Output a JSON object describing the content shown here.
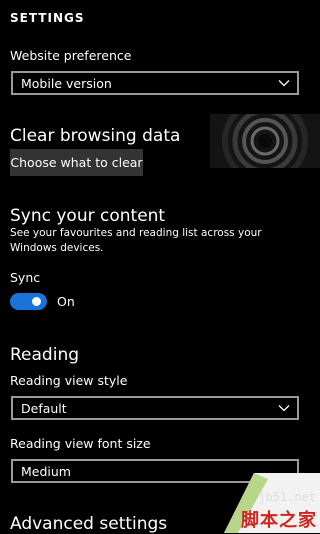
{
  "header": {
    "title": "SETTINGS"
  },
  "website_preference": {
    "label": "Website preference",
    "value": "Mobile version"
  },
  "clear_browsing": {
    "title": "Clear browsing data",
    "button_label": "Choose what to clear"
  },
  "sync": {
    "title": "Sync your content",
    "description": "See your favourites and reading list across your Windows devices.",
    "label": "Sync",
    "state_label": "On",
    "enabled": true
  },
  "reading": {
    "title": "Reading",
    "view_style_label": "Reading view style",
    "view_style_value": "Default",
    "font_size_label": "Reading view font size",
    "font_size_value": "Medium"
  },
  "advanced": {
    "title": "Advanced settings"
  },
  "watermark": {
    "url": "jb51.net",
    "text": "脚本之家"
  },
  "colors": {
    "background": "#000000",
    "accent": "#1a73d9",
    "button": "#333333",
    "field_border": "#9a9a9a"
  }
}
